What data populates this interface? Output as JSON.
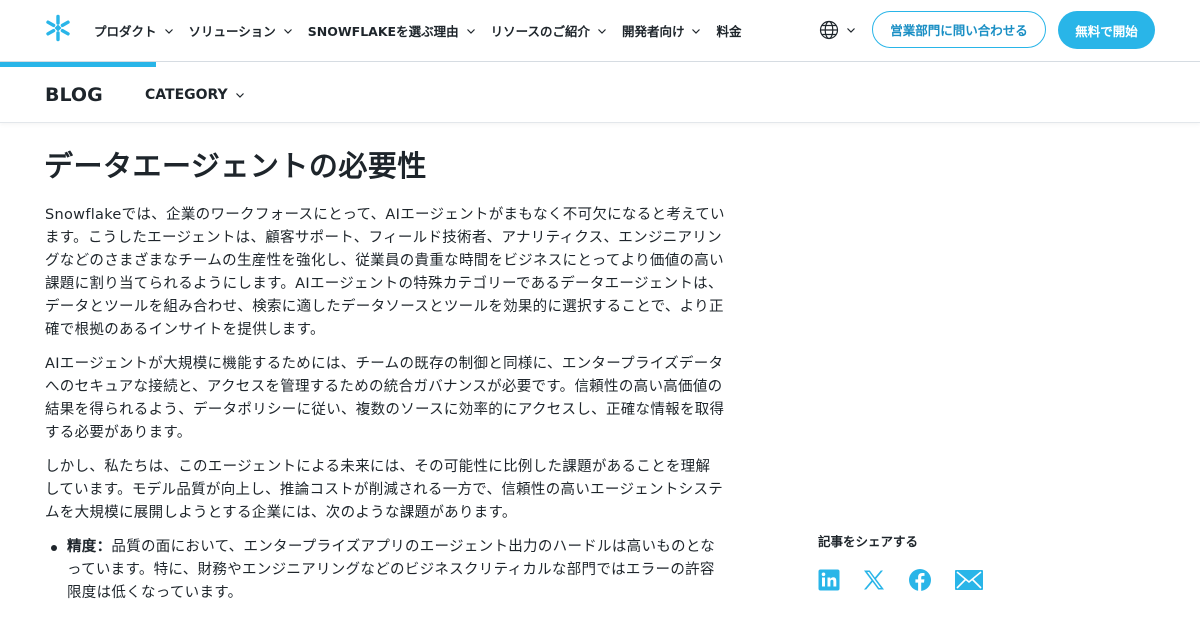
{
  "colors": {
    "accent": "#29b5e8",
    "text": "#1e252b",
    "link": "#1a8fc4"
  },
  "nav": {
    "logo": "snowflake-logo",
    "items": [
      {
        "label": "プロダクト",
        "has_dropdown": true
      },
      {
        "label": "ソリューション",
        "has_dropdown": true
      },
      {
        "label": "SNOWFLAKEを選ぶ理由",
        "has_dropdown": true
      },
      {
        "label": "リソースのご紹介",
        "has_dropdown": true
      },
      {
        "label": "開発者向け",
        "has_dropdown": true
      },
      {
        "label": "料金",
        "has_dropdown": false
      }
    ],
    "language_icon": "globe-icon",
    "contact_sales": "営業部門に問い合わせる",
    "start_free": "無料で開始"
  },
  "subnav": {
    "blog": "BLOG",
    "category": "CATEGORY",
    "reading_progress": 0.13
  },
  "article": {
    "title": "データエージェントの必要性",
    "paragraphs": [
      "Snowflakeでは、企業のワークフォースにとって、AIエージェントがまもなく不可欠になると考えています。こうしたエージェントは、顧客サポート、フィールド技術者、アナリティクス、エンジニアリングなどのさまざまなチームの生産性を強化し、従業員の貴重な時間をビジネスにとってより価値の高い課題に割り当てられるようにします。AIエージェントの特殊カテゴリーであるデータエージェントは、データとツールを組み合わせ、検索に適したデータソースとツールを効果的に選択することで、より正確で根拠のあるインサイトを提供します。",
      "AIエージェントが大規模に機能するためには、チームの既存の制御と同様に、エンタープライズデータへのセキュアな接続と、アクセスを管理するための統合ガバナンスが必要です。信頼性の高い高価値の結果を得られるよう、データポリシーに従い、複数のソースに効率的にアクセスし、正確な情報を取得する必要があります。",
      "しかし、私たちは、このエージェントによる未来には、その可能性に比例した課題があることを理解しています。モデル品質が向上し、推論コストが削減される一方で、信頼性の高いエージェントシステムを大規模に展開しようとする企業には、次のような課題があります。"
    ],
    "bullets": [
      {
        "term": "精度：",
        "text": "品質の面において、エンタープライズアプリのエージェント出力のハードルは高いものとなっています。特に、財務やエンジニアリングなどのビジネスクリティカルな部門ではエラーの許容限度は低くなっています。"
      }
    ]
  },
  "share": {
    "title": "記事をシェアする",
    "icons": [
      "linkedin-icon",
      "x-icon",
      "facebook-icon",
      "email-icon"
    ]
  }
}
